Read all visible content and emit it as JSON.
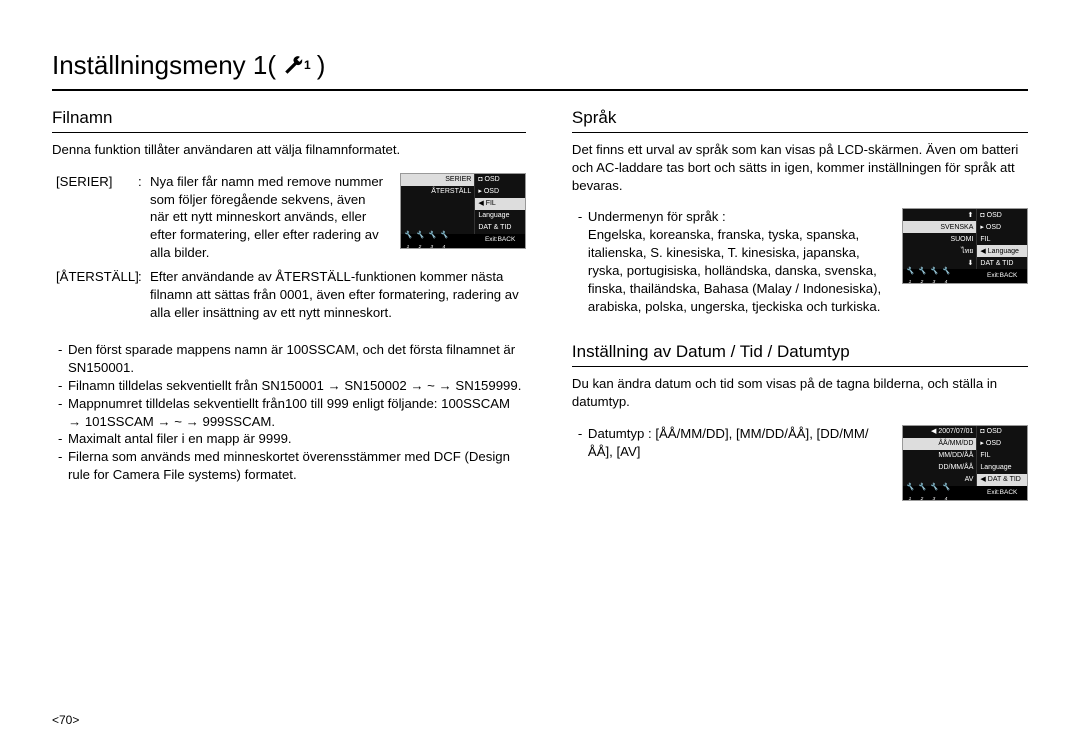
{
  "title": "Inställningsmeny 1(",
  "title_end": ")",
  "icon_sub": "1",
  "footer": "<70>",
  "filnamn": {
    "heading": "Filnamn",
    "intro": "Denna funktion tillåter användaren att välja filnamnformatet.",
    "defs": [
      {
        "term": "[SERIER]",
        "sep": ":",
        "body": "Nya filer får namn med remove nummer som följer föregående sekvens, även när ett nytt minneskort används, eller efter formatering, eller efter radering av alla bilder."
      },
      {
        "term": "[ÅTERSTÄLL]",
        "sep": ":",
        "body": "Efter användande av ÅTERSTÄLL-funktionen kommer nästa filnamn att sättas från 0001, även efter formatering, radering av alla eller insättning av ett nytt minneskort."
      }
    ],
    "notes": [
      "Den först sparade mappens namn är 100SSCAM, och det första filnamnet är SN150001.",
      "Filnamn tilldelas sekventiellt från SN150001 → SN150002 → ~ → SN159999.",
      "Mappnumret tilldelas sekventiellt  från100 till 999 enligt följande: 100SSCAM → 101SSCAM → ~ → 999SSCAM.",
      "Maximalt antal filer i en mapp är 9999.",
      "Filerna som används med minneskortet överensstämmer med DCF (Design rule for Camera File systems) formatet."
    ],
    "lcd": {
      "left": [
        "SERIER",
        "ÅTERSTÄLL",
        "",
        "",
        ""
      ],
      "right": [
        "OSD",
        "OSD",
        "FIL",
        "Language",
        "DAT & TID"
      ],
      "left_sel": 0,
      "right_sel": 2,
      "exit": "Exit:BACK"
    }
  },
  "sprak": {
    "heading": "Språk",
    "intro": "Det finns ett urval av språk som kan visas på LCD-skärmen. Även om batteri och AC-laddare tas bort och sätts in igen, kommer inställningen för språk att bevaras.",
    "sublabel": "Undermenyn för språk :",
    "body": "Engelska, koreanska, franska, tyska, spanska, italienska, S. kinesiska, T. kinesiska, japanska, ryska, portugisiska, holländska, danska, svenska, finska, thailändska, Bahasa (Malay / Indonesiska), arabiska, polska, ungerska, tjeckiska och turkiska.",
    "lcd": {
      "left": [
        "⬆",
        "SVENSKA",
        "SUOMI",
        "ไทย",
        "⬇"
      ],
      "right": [
        "OSD",
        "OSD",
        "FIL",
        "Language",
        "DAT & TID"
      ],
      "left_sel": 1,
      "right_sel": 3,
      "exit": "Exit:BACK"
    }
  },
  "datum": {
    "heading": "Inställning av Datum / Tid / Datumtyp",
    "intro": "Du kan ändra datum och tid som visas på de tagna bilderna, och ställa in datumtyp.",
    "sublabel": "Datumtyp : [ÅÅ/MM/DD], [MM/DD/ÅÅ], [DD/MM/ÅÅ], [AV]",
    "lcd": {
      "left": [
        "2007/07/01",
        "ÅÅ/MM/DD",
        "MM/DD/ÅÅ",
        "DD/MM/ÅÅ",
        "AV"
      ],
      "right": [
        "OSD",
        "OSD",
        "FIL",
        "Language",
        "DAT & TID"
      ],
      "left_sel": 1,
      "right_sel": 4,
      "exit": "Exit:BACK"
    }
  }
}
